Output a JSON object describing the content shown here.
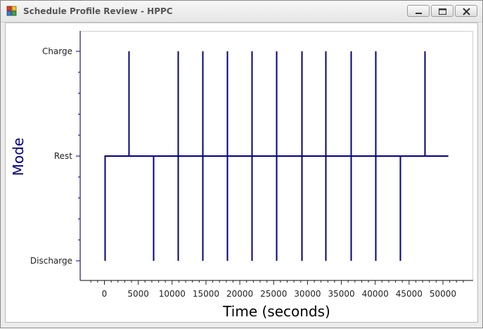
{
  "window": {
    "title": "Schedule Profile Review - HPPC",
    "buttons": [
      "minimize",
      "maximize",
      "close"
    ]
  },
  "colors": {
    "line": "#000080",
    "axis": "#000080",
    "ylabel": "#000080"
  },
  "chart_data": {
    "type": "line",
    "title": "",
    "xlabel": "Time (seconds)",
    "ylabel": "Mode",
    "xlim": [
      -2500,
      54000
    ],
    "xticks": [
      0,
      5000,
      10000,
      15000,
      20000,
      25000,
      30000,
      35000,
      40000,
      45000,
      50000
    ],
    "xtick_labels": [
      "0",
      "5000",
      "10000",
      "15000",
      "20000",
      "25000",
      "30000",
      "35000",
      "40000",
      "45000",
      "50000"
    ],
    "y_categories": [
      "Discharge",
      "Rest",
      "Charge"
    ],
    "y_values": {
      "Discharge": -1,
      "Rest": 0,
      "Charge": 1
    },
    "ylim": [
      -1.2,
      1.2
    ],
    "rest_span": [
      0,
      50800
    ],
    "series": [
      {
        "pulses": [
          {
            "t": 0,
            "mode": "Discharge"
          },
          {
            "t": 3600,
            "mode": "Charge"
          },
          {
            "t": 7200,
            "mode": "Discharge"
          },
          {
            "t": 10800,
            "mode": "Charge"
          },
          {
            "t": 10800,
            "mode": "Discharge"
          },
          {
            "t": 14500,
            "mode": "Charge"
          },
          {
            "t": 14500,
            "mode": "Discharge"
          },
          {
            "t": 18100,
            "mode": "Charge"
          },
          {
            "t": 18100,
            "mode": "Discharge"
          },
          {
            "t": 21800,
            "mode": "Charge"
          },
          {
            "t": 21800,
            "mode": "Discharge"
          },
          {
            "t": 25400,
            "mode": "Charge"
          },
          {
            "t": 25400,
            "mode": "Discharge"
          },
          {
            "t": 29100,
            "mode": "Charge"
          },
          {
            "t": 29100,
            "mode": "Discharge"
          },
          {
            "t": 32700,
            "mode": "Charge"
          },
          {
            "t": 32700,
            "mode": "Discharge"
          },
          {
            "t": 36400,
            "mode": "Charge"
          },
          {
            "t": 36400,
            "mode": "Discharge"
          },
          {
            "t": 40000,
            "mode": "Charge"
          },
          {
            "t": 40000,
            "mode": "Discharge"
          },
          {
            "t": 43700,
            "mode": "Discharge"
          },
          {
            "t": 47300,
            "mode": "Charge"
          }
        ]
      }
    ],
    "grid": false,
    "legend": "none"
  }
}
